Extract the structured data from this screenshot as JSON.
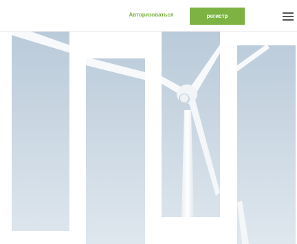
{
  "header": {
    "login_label": "Авторизоваться",
    "register_label": "регистр",
    "menu_icon": "hamburger-menu-icon"
  },
  "colors": {
    "accent": "#7cb342",
    "sky_top": "#b4c6d6",
    "sky_bottom": "#dfe7ee",
    "turbine": "#f7f9fa"
  },
  "hero": {
    "image": "wind-turbine-sky"
  }
}
